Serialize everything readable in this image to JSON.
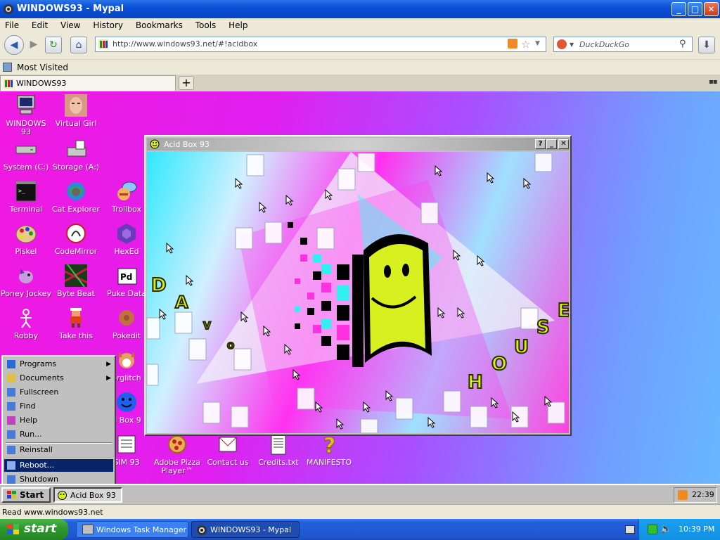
{
  "window": {
    "title": "WINDOWS93 - Mypal",
    "buttons": {
      "minimize": "_",
      "maximize": "□",
      "close": "✕"
    }
  },
  "menubar": [
    "File",
    "Edit",
    "View",
    "History",
    "Bookmarks",
    "Tools",
    "Help"
  ],
  "navbar": {
    "url": "http://www.windows93.net/#!acidbox",
    "search_placeholder": "DuckDuckGo"
  },
  "bookmarks": {
    "most_visited": "Most Visited"
  },
  "tabs": [
    {
      "label": "WINDOWS93"
    }
  ],
  "desktop": {
    "icons": [
      {
        "label": "WINDOWS 93",
        "icon": "computer-icon"
      },
      {
        "label": "Virtual Girl",
        "icon": "face-icon"
      },
      {
        "label": "System (C:)",
        "icon": "drive-icon"
      },
      {
        "label": "Storage (A:)",
        "icon": "floppy-icon"
      },
      {
        "label": "Terminal",
        "icon": "terminal-icon"
      },
      {
        "label": "Cat Explorer",
        "icon": "cat-globe-icon"
      },
      {
        "label": "Trollbox",
        "icon": "chat-icon"
      },
      {
        "label": "Piskel",
        "icon": "palette-icon"
      },
      {
        "label": "CodeMirror",
        "icon": "codemirror-icon"
      },
      {
        "label": "HexEd",
        "icon": "cube-icon"
      },
      {
        "label": "Poney Jockey",
        "icon": "pony-icon"
      },
      {
        "label": "Byte Beat",
        "icon": "bytebeat-icon"
      },
      {
        "label": "Puke Data",
        "icon": "pd-icon"
      },
      {
        "label": "Robby",
        "icon": "stickman-icon"
      },
      {
        "label": "Take this",
        "icon": "pixel-man-icon"
      },
      {
        "label": "Pokedit",
        "icon": "pokeball-icon"
      },
      {
        "label": "orglitch",
        "icon": "dog-icon"
      },
      {
        "label": "d Box 9",
        "icon": "smiley-icon"
      },
      {
        "label": "SIM 93",
        "icon": "book-icon"
      },
      {
        "label": "Adobe Pizza Player™",
        "icon": "pizza-icon"
      },
      {
        "label": "Contact us",
        "icon": "envelope-icon"
      },
      {
        "label": "Credits.txt",
        "icon": "text-file-icon"
      },
      {
        "label": "MANIFESTO",
        "icon": "question-icon"
      }
    ]
  },
  "acidbox": {
    "title": "Acid Box 93",
    "buttons": {
      "help": "?",
      "minimize": "_",
      "close": "✕"
    },
    "letters_left": [
      "D",
      "A",
      "V",
      "O"
    ],
    "letters_right": [
      "H",
      "O",
      "U",
      "S",
      "E"
    ]
  },
  "startmenu": {
    "items": [
      {
        "label": "Programs",
        "submenu": true
      },
      {
        "label": "Documents",
        "submenu": true
      },
      {
        "label": "Fullscreen"
      },
      {
        "label": "Find"
      },
      {
        "label": "Help"
      },
      {
        "label": "Run..."
      },
      {
        "label": "Reinstall"
      },
      {
        "label": "Reboot...",
        "selected": true
      },
      {
        "label": "Shutdown"
      }
    ]
  },
  "w93taskbar": {
    "start": "Start",
    "task": "Acid Box 93",
    "clock": "22:39"
  },
  "statusbar": {
    "text": "Read www.windows93.net"
  },
  "xptaskbar": {
    "start": "start",
    "tasks": [
      "Windows Task Manager",
      "WINDOWS93 - Mypal"
    ],
    "clock": "10:39 PM"
  }
}
